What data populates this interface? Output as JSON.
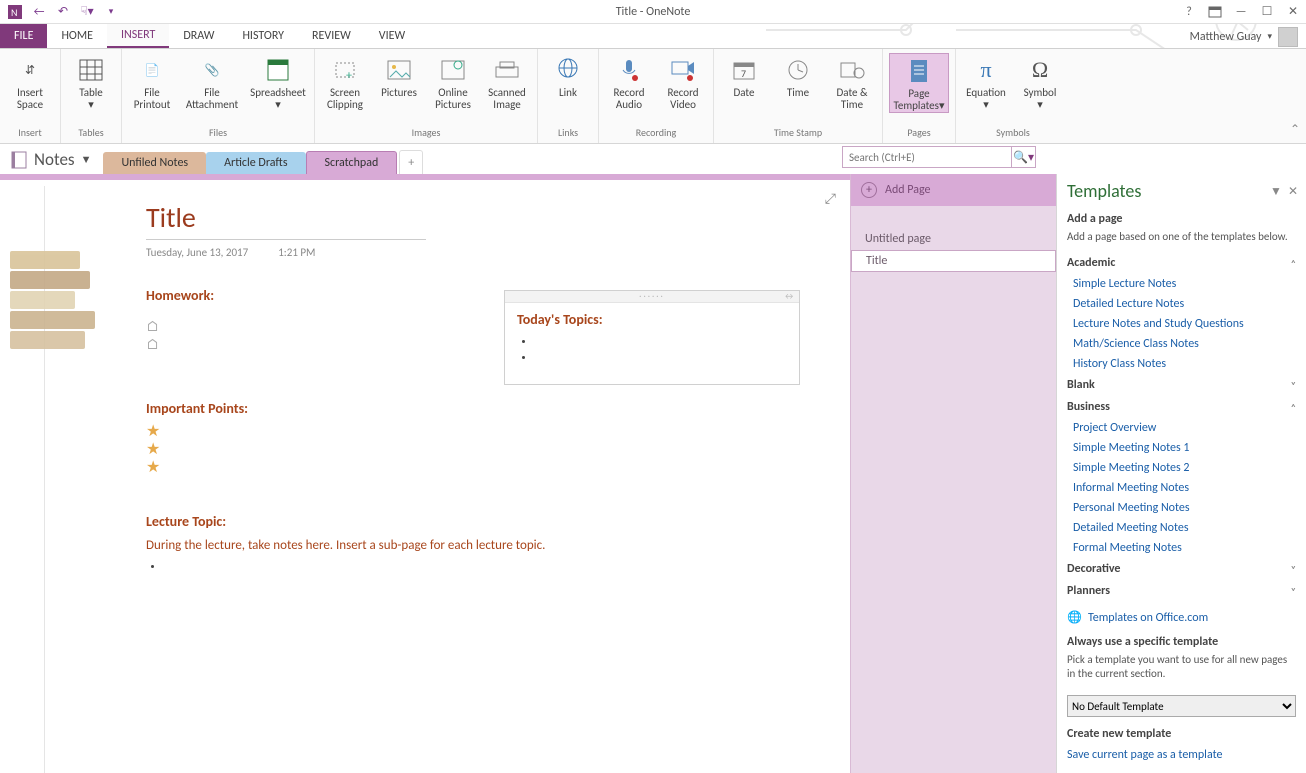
{
  "window": {
    "title": "Title - OneNote"
  },
  "user": {
    "name": "Matthew Guay"
  },
  "ribbonTabs": {
    "file": "FILE",
    "home": "HOME",
    "insert": "INSERT",
    "draw": "DRAW",
    "history": "HISTORY",
    "review": "REVIEW",
    "view": "VIEW"
  },
  "ribbon": {
    "groups": {
      "insert": {
        "title": "Insert",
        "items": {
          "insertSpace": "Insert\nSpace"
        }
      },
      "tables": {
        "title": "Tables",
        "items": {
          "table": "Table"
        }
      },
      "files": {
        "title": "Files",
        "items": {
          "filePrintout": "File\nPrintout",
          "fileAttachment": "File\nAttachment",
          "spreadsheet": "Spreadsheet"
        }
      },
      "images": {
        "title": "Images",
        "items": {
          "screenClipping": "Screen\nClipping",
          "pictures": "Pictures",
          "onlinePictures": "Online\nPictures",
          "scannedImage": "Scanned\nImage"
        }
      },
      "links": {
        "title": "Links",
        "items": {
          "link": "Link"
        }
      },
      "recording": {
        "title": "Recording",
        "items": {
          "recordAudio": "Record\nAudio",
          "recordVideo": "Record\nVideo"
        }
      },
      "timestamp": {
        "title": "Time Stamp",
        "items": {
          "date": "Date",
          "time": "Time",
          "dateTime": "Date &\nTime"
        }
      },
      "pages": {
        "title": "Pages",
        "items": {
          "pageTemplates": "Page\nTemplates"
        }
      },
      "symbols": {
        "title": "Symbols",
        "items": {
          "equation": "Equation",
          "symbol": "Symbol"
        }
      }
    }
  },
  "notebook": {
    "name": "Notes"
  },
  "sections": {
    "s1": "Unfiled Notes",
    "s2": "Article Drafts",
    "s3": "Scratchpad"
  },
  "search": {
    "placeholder": "Search (Ctrl+E)"
  },
  "addPageLabel": "Add Page",
  "pageList": {
    "p1": "Untitled page",
    "p2": "Title"
  },
  "note": {
    "title": "Title",
    "date": "Tuesday, June 13, 2017",
    "time": "1:21 PM",
    "headings": {
      "homework": "Homework:",
      "important": "Important Points:",
      "lecture": "Lecture Topic:",
      "today": "Today's Topics:"
    },
    "lectureBody": "During the lecture, take notes here.  Insert a sub-page for each lecture topic."
  },
  "templates": {
    "title": "Templates",
    "addPageHdr": "Add a page",
    "addPageDesc": "Add a page based on one of the templates below.",
    "cats": {
      "academic": "Academic",
      "blank": "Blank",
      "business": "Business",
      "decorative": "Decorative",
      "planners": "Planners"
    },
    "academic": {
      "l1": "Simple Lecture Notes",
      "l2": "Detailed Lecture Notes",
      "l3": "Lecture Notes and Study Questions",
      "l4": "Math/Science Class Notes",
      "l5": "History Class Notes"
    },
    "business": {
      "l1": "Project Overview",
      "l2": "Simple Meeting Notes 1",
      "l3": "Simple Meeting Notes 2",
      "l4": "Informal Meeting Notes",
      "l5": "Personal Meeting Notes",
      "l6": "Detailed Meeting Notes",
      "l7": "Formal Meeting Notes"
    },
    "officeLink": "Templates on Office.com",
    "alwaysHdr": "Always use a specific template",
    "alwaysDesc": "Pick a template you want to use for all new pages in the current section.",
    "defaultOption": "No Default Template",
    "createHdr": "Create new template",
    "saveLink": "Save current page as a template"
  }
}
